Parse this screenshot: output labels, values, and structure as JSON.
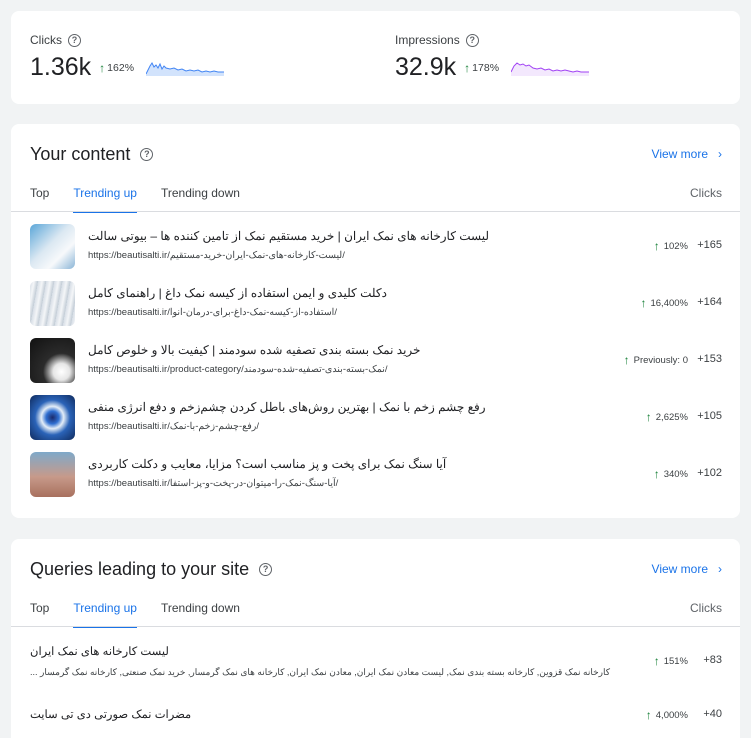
{
  "metrics": {
    "clicks": {
      "label": "Clicks",
      "value": "1.36k",
      "change": "162%",
      "color": "#4285f4"
    },
    "impressions": {
      "label": "Impressions",
      "value": "32.9k",
      "change": "178%",
      "color": "#a142f4"
    }
  },
  "content": {
    "title": "Your content",
    "view_more": "View more",
    "tabs": [
      "Top",
      "Trending up",
      "Trending down"
    ],
    "active_tab": "Trending up",
    "column": "Clicks",
    "rows": [
      {
        "title": "لیست کارخانه های نمک ایران | خرید مستقیم نمک از تامین کننده ها – بیوتی سالت",
        "url": "https://beautisalti.ir/لیست-کارخانه-های-نمک-ایران-خرید-مستقیم/",
        "change": "102%",
        "clicks": "+165"
      },
      {
        "title": "دکلت کلیدی و ایمن استفاده از کیسه نمک داغ | راهنمای کامل",
        "url": "https://beautisalti.ir/استفاده-از-کیسه-نمک-داغ-برای-درمان-انوا/",
        "change": "16,400%",
        "clicks": "+164"
      },
      {
        "title": "خرید نمک بسته بندی تصفیه شده سودمند | کیفیت بالا و خلوص کامل",
        "url": "https://beautisalti.ir/product-category/نمک-بسته-بندی-تصفیه-شده-سودمند/",
        "change": "Previously: 0",
        "clicks": "+153"
      },
      {
        "title": "رفع چشم زخم با نمک | بهترین روش‌های باطل کردن چشم‌زخم و دفع انرژی منفی",
        "url": "https://beautisalti.ir/رفع-چشم-زخم-با-نمک/",
        "change": "2,625%",
        "clicks": "+105"
      },
      {
        "title": "آیا سنگ نمک برای پخت و پز مناسب است؟ مزایا، معایب و دکلت کاربردی",
        "url": "https://beautisalti.ir/آیا-سنگ-نمک-را-میتوان-در-پخت-و-پز-استفا/",
        "change": "340%",
        "clicks": "+102"
      }
    ]
  },
  "queries": {
    "title": "Queries leading to your site",
    "view_more": "View more",
    "tabs": [
      "Top",
      "Trending up",
      "Trending down"
    ],
    "active_tab": "Trending up",
    "column": "Clicks",
    "rows": [
      {
        "title": "لیست کارخانه های نمک ایران",
        "sub": "کارخانه نمک قزوین, کارخانه بسته بندی نمک, لیست معادن نمک ایران, معادن نمک ایران, کارخانه های نمک گرمسار, خرید نمک صنعتی, کارخانه نمک گرمسار ...",
        "change": "151%",
        "clicks": "+83"
      },
      {
        "title": "مضرات نمک صورتی دی تی سایت",
        "sub": "",
        "change": "4,000%",
        "clicks": "+40"
      }
    ]
  }
}
